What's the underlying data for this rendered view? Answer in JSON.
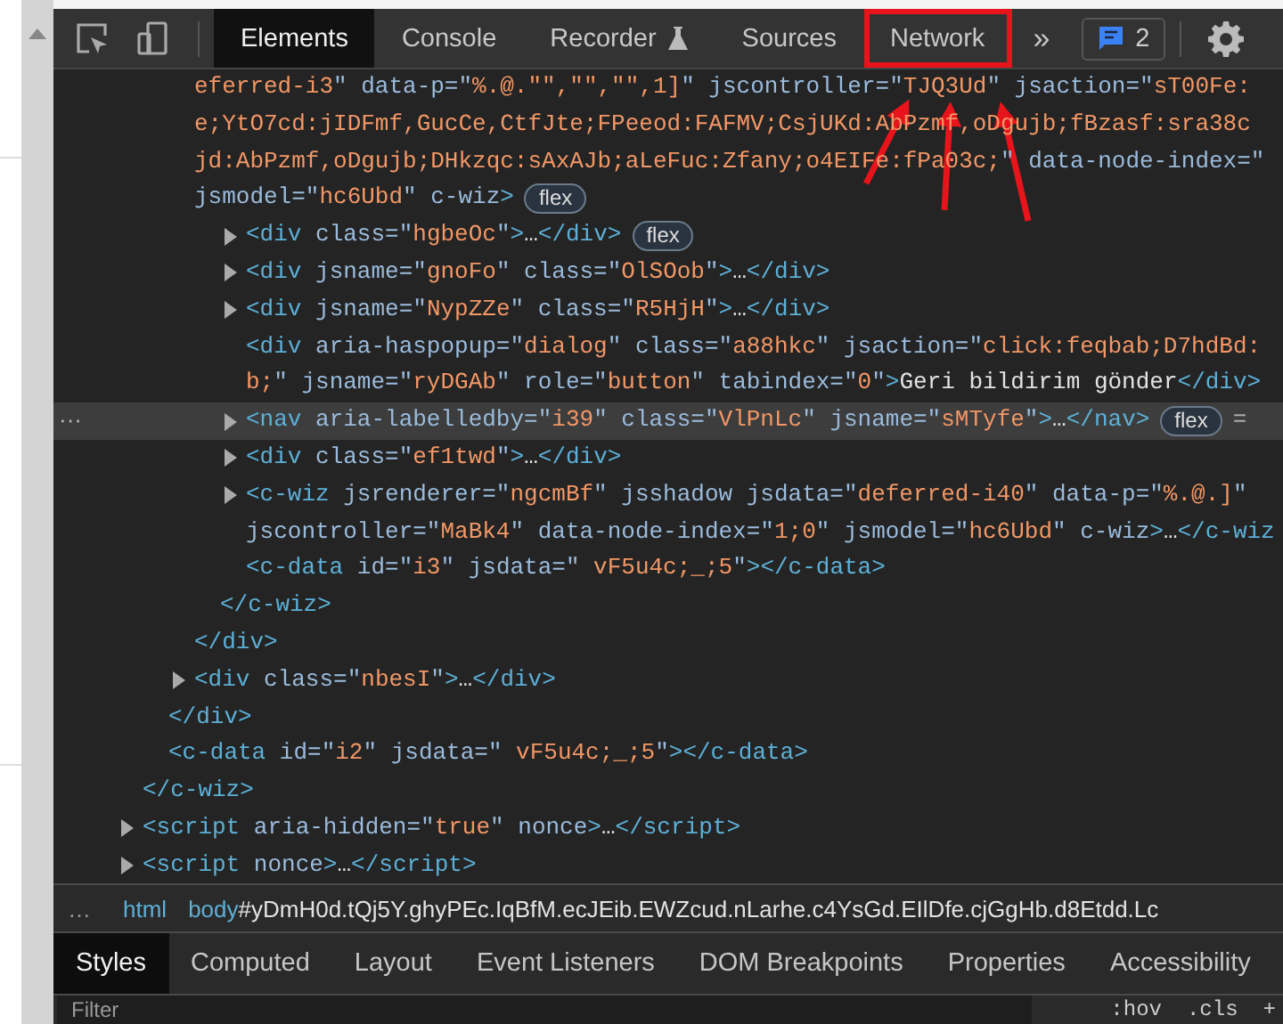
{
  "toolbar": {
    "tabs": [
      {
        "label": "Elements",
        "selected": true,
        "highlighted": false,
        "kind": "plain"
      },
      {
        "label": "Console",
        "selected": false,
        "highlighted": false,
        "kind": "plain"
      },
      {
        "label": "Recorder",
        "selected": false,
        "highlighted": false,
        "kind": "experimental"
      },
      {
        "label": "Sources",
        "selected": false,
        "highlighted": false,
        "kind": "plain"
      },
      {
        "label": "Network",
        "selected": false,
        "highlighted": true,
        "kind": "plain"
      }
    ],
    "more_tabs": "»",
    "issues_count": "2"
  },
  "elements": {
    "selection_marker": "···",
    "nodes": [
      {
        "children": [
          {
            "children": [
              {
                "selected": false,
                "toggle": false,
                "lines": [
                  [
                    {
                      "value": "eferred-i3"
                    },
                    {
                      "attr": "\" data-p=\""
                    },
                    {
                      "value": "%.@.\"\",\"\",\"\",1]"
                    },
                    {
                      "attr": "\" jscontroller=\""
                    },
                    {
                      "value": "TJQ3Ud"
                    },
                    {
                      "attr": "\" jsaction=\""
                    },
                    {
                      "value": "sT00Fe:"
                    }
                  ],
                  [
                    {
                      "value": "e;YtO7cd:jIDFmf,GucCe,CtfJte;FPeeod:FAFMV;CsjUKd:AbPzmf,oDgujb;fBzasf:sra38c"
                    }
                  ],
                  [
                    {
                      "value": "jd:AbPzmf,oDgujb;DHkzqc:sAxAJb;aLeFuc:Zfany;o4EIFe:fPa03c;"
                    },
                    {
                      "attr": "\" data-node-index=\""
                    }
                  ],
                  [
                    {
                      "attr": "jsmodel=\""
                    },
                    {
                      "value": "hc6Ubd"
                    },
                    {
                      "attr": "\" c-wiz"
                    },
                    {
                      "tag": ">"
                    }
                  ]
                ],
                "badge": "flex",
                "children": [
                  {
                    "children": [
                      {
                        "selected": false,
                        "toggle": true,
                        "lines": [
                          [
                            {
                              "tag": "<div"
                            },
                            {
                              "attr": " class=\""
                            },
                            {
                              "value": "hgbeOc"
                            },
                            {
                              "attr": "\""
                            },
                            {
                              "tag": ">"
                            },
                            {
                              "text": "…"
                            },
                            {
                              "tag": "</div>"
                            }
                          ]
                        ],
                        "badge": "flex"
                      },
                      {
                        "selected": false,
                        "toggle": true,
                        "lines": [
                          [
                            {
                              "tag": "<div"
                            },
                            {
                              "attr": " jsname=\""
                            },
                            {
                              "value": "gnoFo"
                            },
                            {
                              "attr": "\" class=\""
                            },
                            {
                              "value": "OlSOob"
                            },
                            {
                              "attr": "\""
                            },
                            {
                              "tag": ">"
                            },
                            {
                              "text": "…"
                            },
                            {
                              "tag": "</div>"
                            }
                          ]
                        ]
                      },
                      {
                        "selected": false,
                        "toggle": true,
                        "lines": [
                          [
                            {
                              "tag": "<div"
                            },
                            {
                              "attr": " jsname=\""
                            },
                            {
                              "value": "NypZZe"
                            },
                            {
                              "attr": "\" class=\""
                            },
                            {
                              "value": "R5HjH"
                            },
                            {
                              "attr": "\""
                            },
                            {
                              "tag": ">"
                            },
                            {
                              "text": "…"
                            },
                            {
                              "tag": "</div>"
                            }
                          ]
                        ]
                      },
                      {
                        "selected": false,
                        "toggle": false,
                        "lines": [
                          [
                            {
                              "tag": "<div"
                            },
                            {
                              "attr": " aria-haspopup=\""
                            },
                            {
                              "value": "dialog"
                            },
                            {
                              "attr": "\" class=\""
                            },
                            {
                              "value": "a88hkc"
                            },
                            {
                              "attr": "\" jsaction=\""
                            },
                            {
                              "value": "click:feqbab;D7hdBd:"
                            }
                          ],
                          [
                            {
                              "value": "b;"
                            },
                            {
                              "attr": "\" jsname=\""
                            },
                            {
                              "value": "ryDGAb"
                            },
                            {
                              "attr": "\" role=\""
                            },
                            {
                              "value": "button"
                            },
                            {
                              "attr": "\" tabindex=\""
                            },
                            {
                              "value": "0"
                            },
                            {
                              "attr": "\""
                            },
                            {
                              "tag": ">"
                            },
                            {
                              "text": "Geri bildirim gönder"
                            },
                            {
                              "tag": "</div>"
                            }
                          ]
                        ]
                      },
                      {
                        "selected": true,
                        "toggle": true,
                        "lines": [
                          [
                            {
                              "tag": "<nav"
                            },
                            {
                              "attr": " aria-labelledby=\""
                            },
                            {
                              "value": "i39"
                            },
                            {
                              "attr": "\" class=\""
                            },
                            {
                              "value": "VlPnLc"
                            },
                            {
                              "attr": "\" jsname=\""
                            },
                            {
                              "value": "sMTyfe"
                            },
                            {
                              "attr": "\""
                            },
                            {
                              "tag": ">"
                            },
                            {
                              "text": "…"
                            },
                            {
                              "tag": "</nav>"
                            }
                          ]
                        ],
                        "badge": "flex",
                        "trail": "="
                      },
                      {
                        "selected": false,
                        "toggle": true,
                        "lines": [
                          [
                            {
                              "tag": "<div"
                            },
                            {
                              "attr": " class=\""
                            },
                            {
                              "value": "ef1twd"
                            },
                            {
                              "attr": "\""
                            },
                            {
                              "tag": ">"
                            },
                            {
                              "text": "…"
                            },
                            {
                              "tag": "</div>"
                            }
                          ]
                        ]
                      },
                      {
                        "selected": false,
                        "toggle": true,
                        "lines": [
                          [
                            {
                              "tag": "<c-wiz"
                            },
                            {
                              "attr": " jsrenderer=\""
                            },
                            {
                              "value": "ngcmBf"
                            },
                            {
                              "attr": "\" jsshadow jsdata=\""
                            },
                            {
                              "value": "deferred-i40"
                            },
                            {
                              "attr": "\" data-p=\""
                            },
                            {
                              "value": "%.@.]"
                            },
                            {
                              "attr": "\""
                            }
                          ],
                          [
                            {
                              "attr": "jscontroller=\""
                            },
                            {
                              "value": "MaBk4"
                            },
                            {
                              "attr": "\" data-node-index=\""
                            },
                            {
                              "value": "1;0"
                            },
                            {
                              "attr": "\" jsmodel=\""
                            },
                            {
                              "value": "hc6Ubd"
                            },
                            {
                              "attr": "\" c-wiz"
                            },
                            {
                              "tag": ">"
                            },
                            {
                              "text": "…"
                            },
                            {
                              "tag": "</c-wiz"
                            }
                          ]
                        ]
                      },
                      {
                        "selected": false,
                        "toggle": false,
                        "lines": [
                          [
                            {
                              "tag": "<c-data"
                            },
                            {
                              "attr": " id=\""
                            },
                            {
                              "value": "i3"
                            },
                            {
                              "attr": "\" jsdata=\""
                            },
                            {
                              "value": " vF5u4c;_;5"
                            },
                            {
                              "attr": "\""
                            },
                            {
                              "tag": "></c-data>"
                            }
                          ]
                        ]
                      }
                    ]
                  },
                  {
                    "selected": false,
                    "toggle": false,
                    "lines": [
                      [
                        {
                          "tag": "</c-wiz>"
                        }
                      ]
                    ]
                  }
                ]
              },
              {
                "selected": false,
                "toggle": false,
                "lines": [
                  [
                    {
                      "tag": "</div>"
                    }
                  ]
                ]
              },
              {
                "selected": false,
                "toggle": true,
                "lines": [
                  [
                    {
                      "tag": "<div"
                    },
                    {
                      "attr": " class=\""
                    },
                    {
                      "value": "nbesI"
                    },
                    {
                      "attr": "\""
                    },
                    {
                      "tag": ">"
                    },
                    {
                      "text": "…"
                    },
                    {
                      "tag": "</div>"
                    }
                  ]
                ]
              }
            ]
          },
          {
            "selected": false,
            "toggle": false,
            "lines": [
              [
                {
                  "tag": "</div>"
                }
              ]
            ]
          },
          {
            "selected": false,
            "toggle": false,
            "lines": [
              [
                {
                  "tag": "<c-data"
                },
                {
                  "attr": " id=\""
                },
                {
                  "value": "i2"
                },
                {
                  "attr": "\" jsdata=\""
                },
                {
                  "value": " vF5u4c;_;5"
                },
                {
                  "attr": "\""
                },
                {
                  "tag": "></c-data>"
                }
              ]
            ]
          }
        ]
      },
      {
        "selected": false,
        "toggle": false,
        "lines": [
          [
            {
              "tag": "</c-wiz>"
            }
          ]
        ]
      },
      {
        "selected": false,
        "toggle": true,
        "lines": [
          [
            {
              "tag": "<script"
            },
            {
              "attr": " aria-hidden=\""
            },
            {
              "value": "true"
            },
            {
              "attr": "\" nonce"
            },
            {
              "tag": ">"
            },
            {
              "text": "…"
            },
            {
              "tag": "</script>"
            }
          ]
        ]
      },
      {
        "selected": false,
        "toggle": true,
        "lines": [
          [
            {
              "tag": "<script"
            },
            {
              "attr": " nonce"
            },
            {
              "tag": ">"
            },
            {
              "text": "…"
            },
            {
              "tag": "</script>"
            }
          ]
        ]
      }
    ]
  },
  "breadcrumb": {
    "overflow": "…",
    "items": [
      [
        {
          "tag": "html"
        }
      ],
      [
        {
          "tag": "body"
        },
        {
          "text": "#yDmH0d.tQj5Y.ghyPEc.IqBfM.ecJEib.EWZcud.nLarhe.c4YsGd.EIlDfe.cjGgHb.d8Etdd.Lc"
        }
      ]
    ]
  },
  "styles_tabs": [
    {
      "label": "Styles",
      "selected": true
    },
    {
      "label": "Computed",
      "selected": false
    },
    {
      "label": "Layout",
      "selected": false
    },
    {
      "label": "Event Listeners",
      "selected": false
    },
    {
      "label": "DOM Breakpoints",
      "selected": false
    },
    {
      "label": "Properties",
      "selected": false
    },
    {
      "label": "Accessibility",
      "selected": false
    }
  ],
  "filter": {
    "placeholder": "Filter",
    "buttons": [
      ":hov",
      ".cls",
      "+"
    ]
  }
}
